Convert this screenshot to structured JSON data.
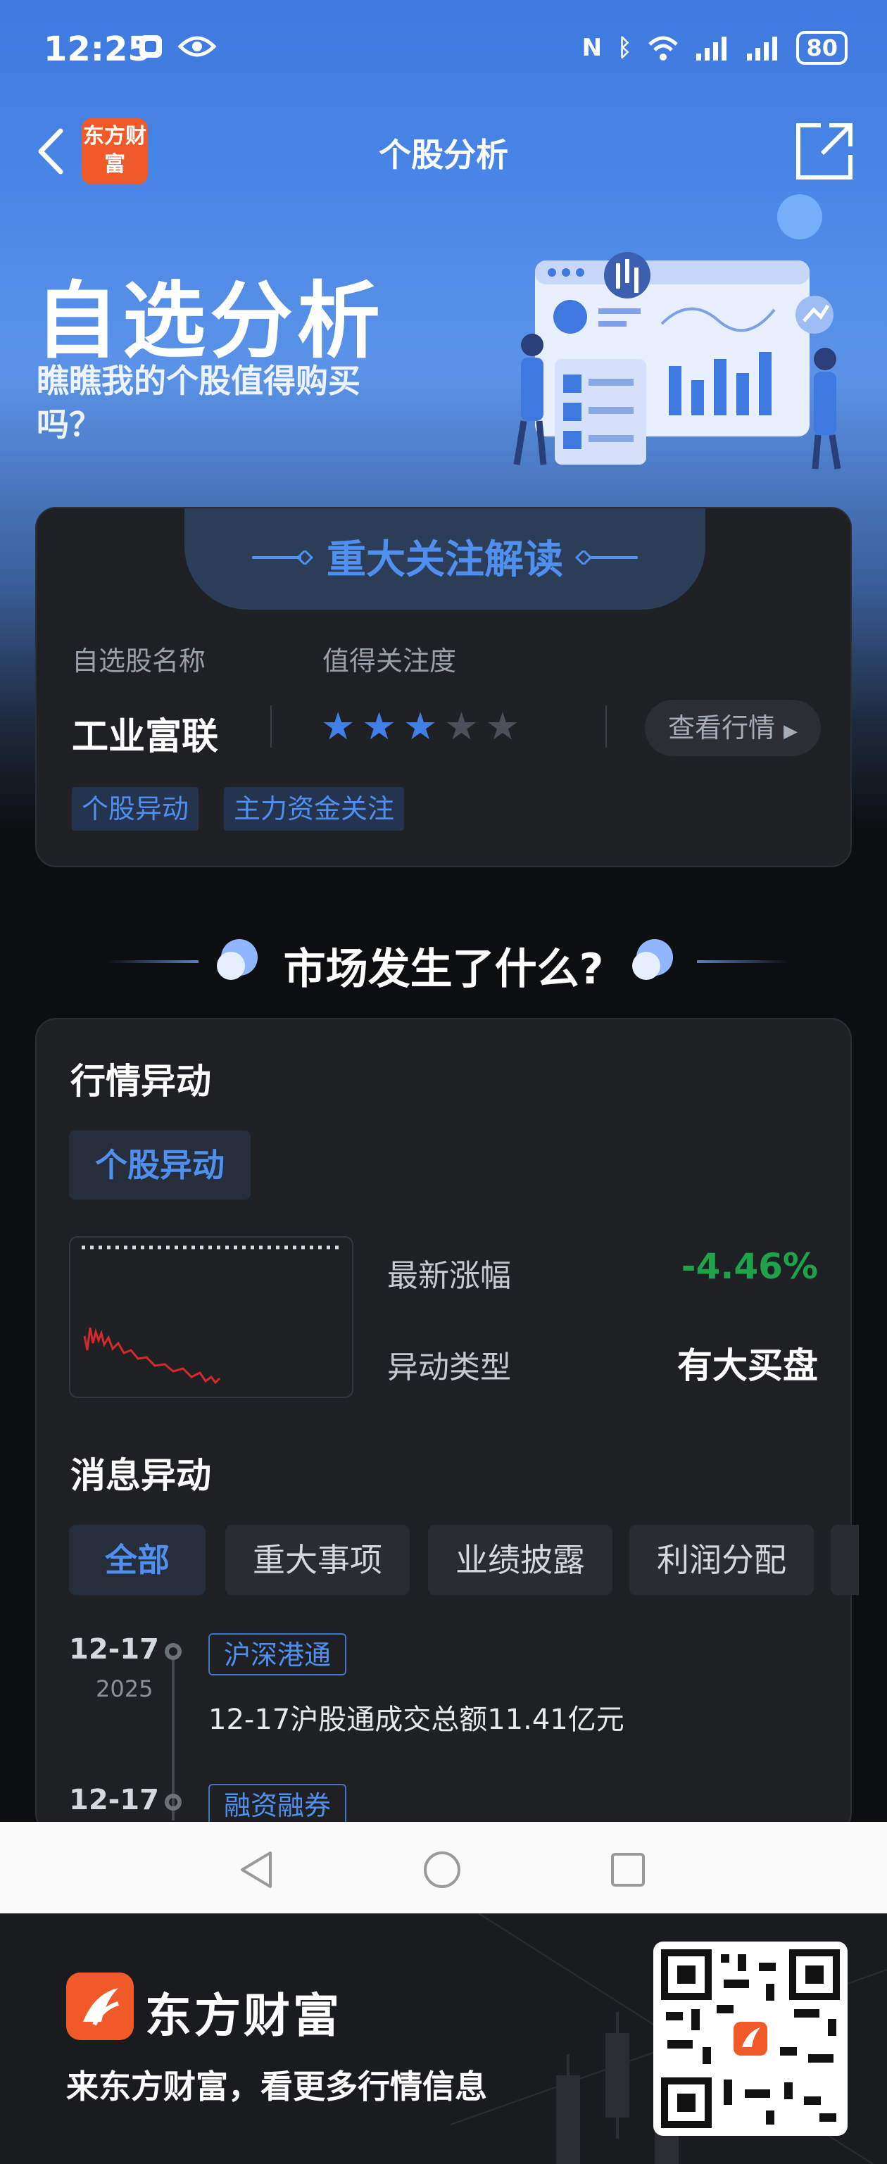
{
  "status_bar": {
    "time": "12:25",
    "battery": "80"
  },
  "nav": {
    "title": "个股分析",
    "logo_text": "东方财富"
  },
  "hero": {
    "title": "自选分析",
    "subtitle": "瞧瞧我的个股值得购买吗？"
  },
  "focus_card": {
    "title": "重大关注解读",
    "name_label": "自选股名称",
    "attention_label": "值得关注度",
    "stock_name": "工业富联",
    "rating": 3,
    "rating_max": 5,
    "view_button": "查看行情",
    "tags": [
      "个股异动",
      "主力资金关注"
    ]
  },
  "section": {
    "title": "市场发生了什么?"
  },
  "market_card": {
    "quote_title": "行情异动",
    "quote_pill": "个股异动",
    "latest_change_label": "最新涨幅",
    "latest_change_value": "-4.46%",
    "anomaly_type_label": "异动类型",
    "anomaly_type_value": "有大买盘",
    "news_title": "消息异动",
    "filters": [
      "全部",
      "重大事项",
      "业绩披露",
      "利润分配"
    ],
    "timeline": [
      {
        "date": "12-17",
        "year": "2025",
        "tag": "沪深港通",
        "text": "12-17沪股通成交总额11.41亿元"
      },
      {
        "date": "12-17",
        "year": "",
        "tag": "融资融券",
        "text": ""
      }
    ]
  },
  "footer": {
    "brand": "东方财富",
    "slogan": "来东方财富，看更多行情信息"
  },
  "colors": {
    "accent": "#4f8ff0",
    "down": "#1fa34a",
    "brand": "#f05a28"
  }
}
